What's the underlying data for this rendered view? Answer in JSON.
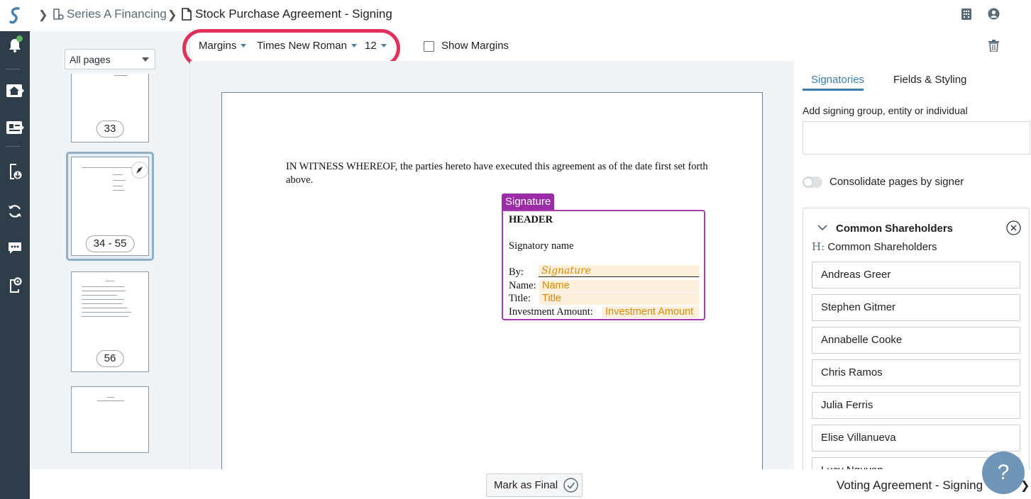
{
  "breadcrumb": {
    "workspace": "Series A Financing",
    "document": "Stock Purchase Agreement - Signing"
  },
  "thumbnails": {
    "filter": "All pages",
    "pages": [
      {
        "label": "33"
      },
      {
        "label": "34 - 55"
      },
      {
        "label": "56"
      }
    ]
  },
  "toolbar": {
    "margins": "Margins",
    "font": "Times New Roman",
    "size": "12",
    "show_margins": "Show Margins"
  },
  "document": {
    "body": "IN WITNESS WHEREOF, the parties hereto have executed this agreement as of the date first set forth above.",
    "signature_block": {
      "tag": "Signature",
      "header": "HEADER",
      "signatory": "Signatory name",
      "by_label": "By:",
      "by_field": "Signature",
      "name_label": "Name:",
      "name_field": "Name",
      "title_label": "Title:",
      "title_field": "Title",
      "amount_label": "Investment Amount:",
      "amount_field": "Investment Amount"
    }
  },
  "panel": {
    "tabs": [
      {
        "label": "Signatories",
        "active": true
      },
      {
        "label": "Fields & Styling",
        "active": false
      }
    ],
    "add_label": "Add signing group, entity or individual",
    "consolidate_label": "Consolidate pages by signer",
    "group": {
      "title": "Common Shareholders",
      "header_prefix": "H:",
      "header_value": "Common Shareholders",
      "signers": [
        "Andreas Greer",
        "Stephen Gitmer",
        "Annabelle Cooke",
        "Chris Ramos",
        "Julia Ferris",
        "Elise Villanueva",
        "Lucy Nguyen"
      ]
    }
  },
  "footer": {
    "mark_final": "Mark as Final",
    "next_document": "Voting Agreement - Signing -"
  },
  "help": {
    "label": "?"
  },
  "colors": {
    "rail": "#2f3d4a",
    "accent": "#3a7cb0",
    "signature": "#9b2ba6",
    "field": "#d98a00",
    "highlight": "#e2325c"
  }
}
